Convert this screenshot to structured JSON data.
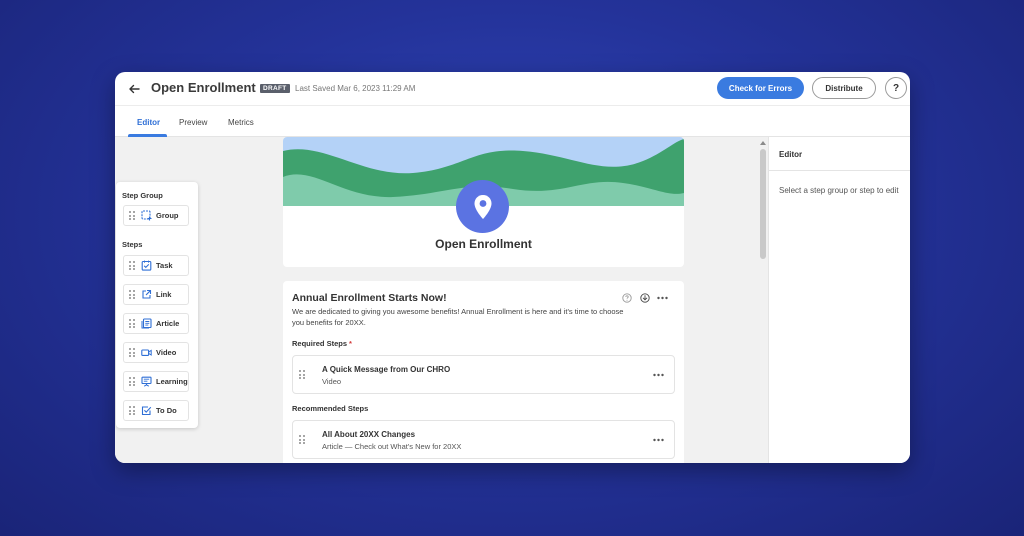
{
  "header": {
    "title": "Open Enrollment",
    "badge": "DRAFT",
    "last_saved": "Last Saved Mar 6, 2023 11:29 AM",
    "check_errors_label": "Check for Errors",
    "distribute_label": "Distribute",
    "help_label": "?"
  },
  "tabs": [
    {
      "label": "Editor",
      "active": true
    },
    {
      "label": "Preview",
      "active": false
    },
    {
      "label": "Metrics",
      "active": false
    }
  ],
  "palette": {
    "step_group_heading": "Step Group",
    "group_label": "Group",
    "steps_heading": "Steps",
    "items": [
      {
        "label": "Task",
        "icon": "task-icon"
      },
      {
        "label": "Link",
        "icon": "link-icon"
      },
      {
        "label": "Article",
        "icon": "article-icon"
      },
      {
        "label": "Video",
        "icon": "video-icon"
      },
      {
        "label": "Learning",
        "icon": "learning-icon"
      },
      {
        "label": "To Do",
        "icon": "todo-icon"
      }
    ]
  },
  "hero": {
    "title": "Open Enrollment",
    "icon": "location-pin-icon"
  },
  "content": {
    "title": "Annual Enrollment Starts Now!",
    "description": "We are dedicated to giving you awesome benefits! Annual Enrollment is here and it's time to choose you benefits for 20XX.",
    "required_label": "Required Steps",
    "required_marker": "*",
    "recommended_label": "Recommended Steps",
    "required_steps": [
      {
        "title": "A Quick Message from Our CHRO",
        "subtitle": "Video"
      }
    ],
    "recommended_steps": [
      {
        "title": "All About 20XX Changes",
        "subtitle": "Article — Check out What's New for 20XX"
      }
    ]
  },
  "right_panel": {
    "title": "Editor",
    "hint": "Select a step group or step to edit"
  },
  "colors": {
    "accent": "#3a7be0",
    "background": "#24339a",
    "hero_sky": "#b4d2f7",
    "hero_hill_dark": "#3fa26e",
    "hero_hill_light": "#7fcbab",
    "pin": "#5b73e2"
  }
}
